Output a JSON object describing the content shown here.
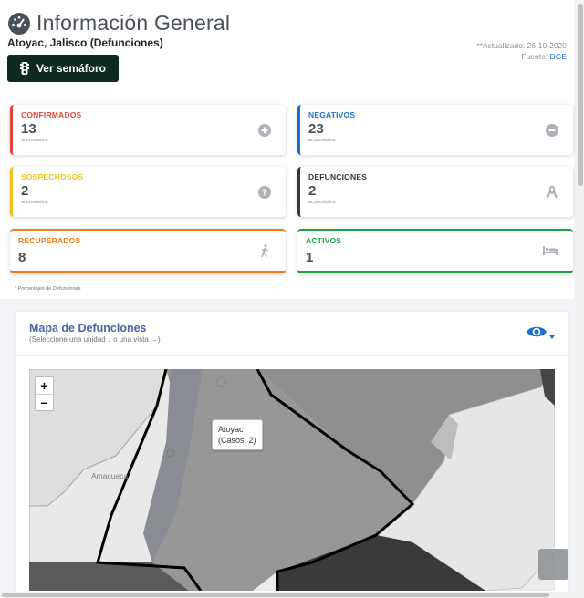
{
  "header": {
    "title": "Información General",
    "subtitle": "Atoyac, Jalisco (Defunciones)",
    "updated": "**Actualizado: 26-10-2020",
    "source_prefix": "Fuente: ",
    "source": "DGE",
    "semaforo_button": "Ver semáforo"
  },
  "stats": [
    {
      "label": "CONFIRMADOS",
      "value": "13",
      "sub": "acumulados",
      "color": "#e0463a",
      "icon": "plus-circle-icon"
    },
    {
      "label": "NEGATIVOS",
      "value": "23",
      "sub": "acumulados",
      "color": "#1b6fd1",
      "icon": "minus-circle-icon"
    },
    {
      "label": "SOSPECHOSOS",
      "value": "2",
      "sub": "acumulados",
      "color": "#f1c21b",
      "icon": "question-circle-icon"
    },
    {
      "label": "DEFUNCIONES",
      "value": "2",
      "sub": "acumulados",
      "color": "#343a40",
      "icon": "ribbon-icon"
    },
    {
      "label": "RECUPERADOS",
      "value": "8",
      "sub": "",
      "color": "#f07d1b",
      "icon": "walking-icon"
    },
    {
      "label": "ACTIVOS",
      "value": "1",
      "sub": "",
      "color": "#21a146",
      "icon": "bed-icon"
    }
  ],
  "note": "* Porcentajes de Defunciones",
  "map": {
    "title": "Mapa de Defunciones",
    "hint": "(Seleccione una unidad ↓ o una vista →)",
    "zoom_in": "+",
    "zoom_out": "−",
    "tooltip_name": "Atoyac",
    "tooltip_cases": "(Casos: 2)",
    "place_label": "Amacueca",
    "eye_icon": "eye-icon"
  }
}
